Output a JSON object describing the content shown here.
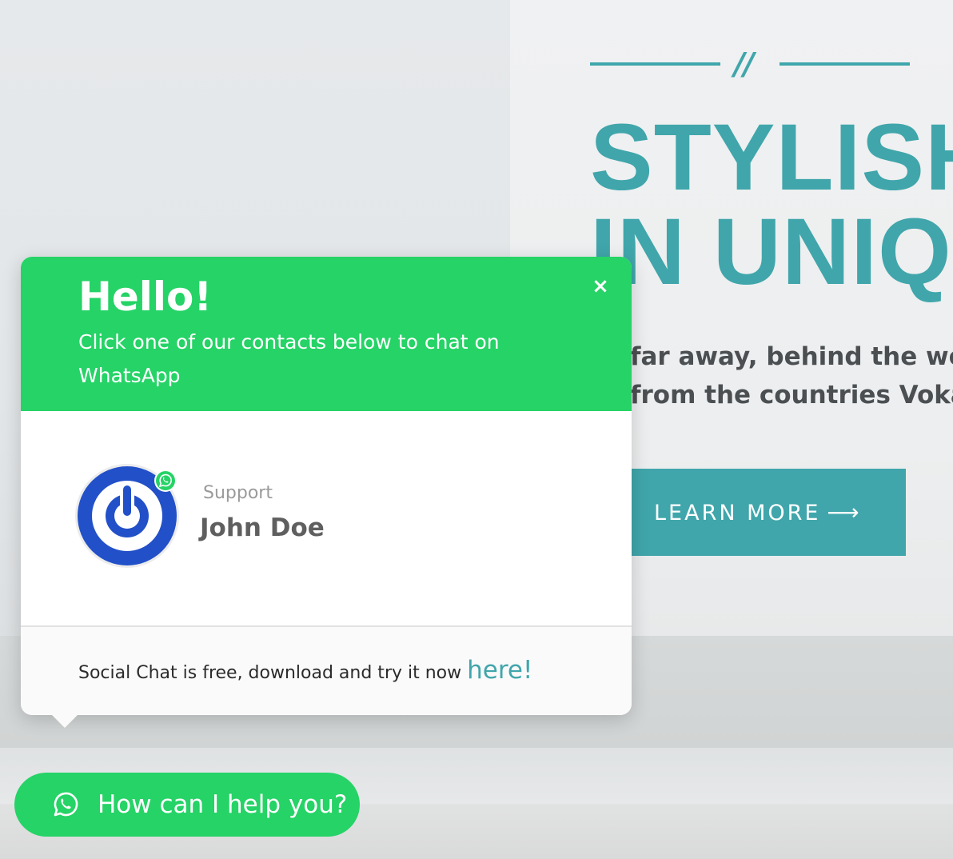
{
  "hero": {
    "divider_symbol": "//",
    "title_line1": "STYLISH",
    "title_line2": "IN UNIQ",
    "text_line1": "far away, behind the word m",
    "text_line2": "from the countries Vokalia a",
    "button_label": "LEARN MORE",
    "button_arrow": "⟶"
  },
  "chat": {
    "greeting": "Hello!",
    "subtitle": "Click one of our contacts below to chat on WhatsApp",
    "close_symbol": "×",
    "contact": {
      "role": "Support",
      "name": "John Doe"
    },
    "footer": {
      "text": "Social Chat is free, download and try it now ",
      "link_text": "here!"
    }
  },
  "launcher": {
    "label": "How can I help you?"
  },
  "colors": {
    "accent_teal": "#40a6ab",
    "whatsapp_green": "#25d366",
    "avatar_blue": "#2250c8"
  }
}
